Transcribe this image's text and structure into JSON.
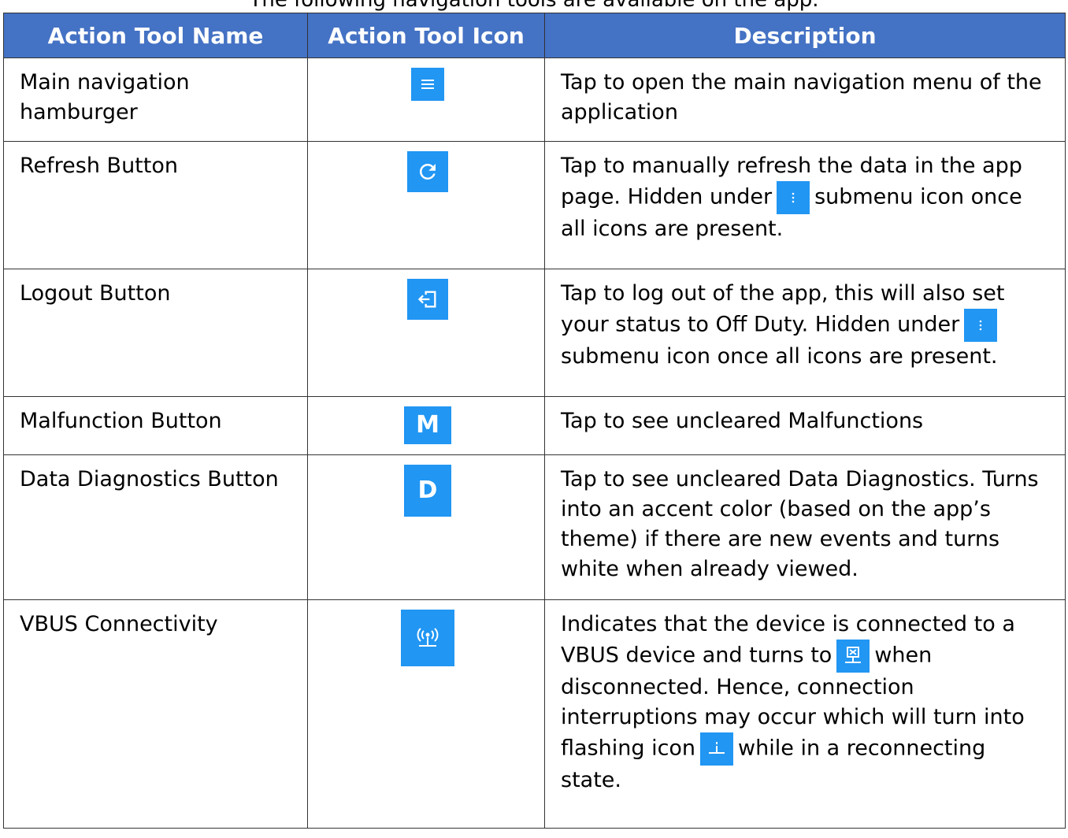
{
  "caption": "The following navigation tools are available on the app.",
  "colors": {
    "header_bg": "#4472c4",
    "icon_bg": "#2196f3",
    "border": "#333333"
  },
  "headers": {
    "name": "Action Tool Name",
    "icon": "Action Tool Icon",
    "description": "Description"
  },
  "rows": [
    {
      "name": "Main navigation hamburger",
      "icon": "hamburger-menu-icon",
      "description": "Tap to open the main navigation menu of the application"
    },
    {
      "name": "Refresh Button",
      "icon": "refresh-icon",
      "description_a": "Tap to manually refresh the data in the app page. Hidden under",
      "description_b": "submenu icon once all icons are present."
    },
    {
      "name": "Logout Button",
      "icon": "logout-icon",
      "description_a": "Tap to log out of the app, this will also set your status to Off Duty. Hidden under",
      "description_b": "submenu icon once all icons are present."
    },
    {
      "name": "Malfunction Button",
      "icon": "malfunction-m-icon",
      "icon_letter": "M",
      "description": "Tap to see uncleared Malfunctions"
    },
    {
      "name": "Data Diagnostics Button",
      "icon": "data-diagnostics-d-icon",
      "icon_letter": "D",
      "description": "Tap to see uncleared Data Diagnostics. Turns into an accent color (based on the app’s theme) if there are new events and turns white when already viewed."
    },
    {
      "name": "VBUS Connectivity",
      "icon": "vbus-connected-icon",
      "description_a": "Indicates that the device is connected to a VBUS device and turns to",
      "description_b": "when disconnected. Hence, connection interruptions may occur which will turn into flashing icon",
      "description_c": "while in a reconnecting state."
    }
  ]
}
